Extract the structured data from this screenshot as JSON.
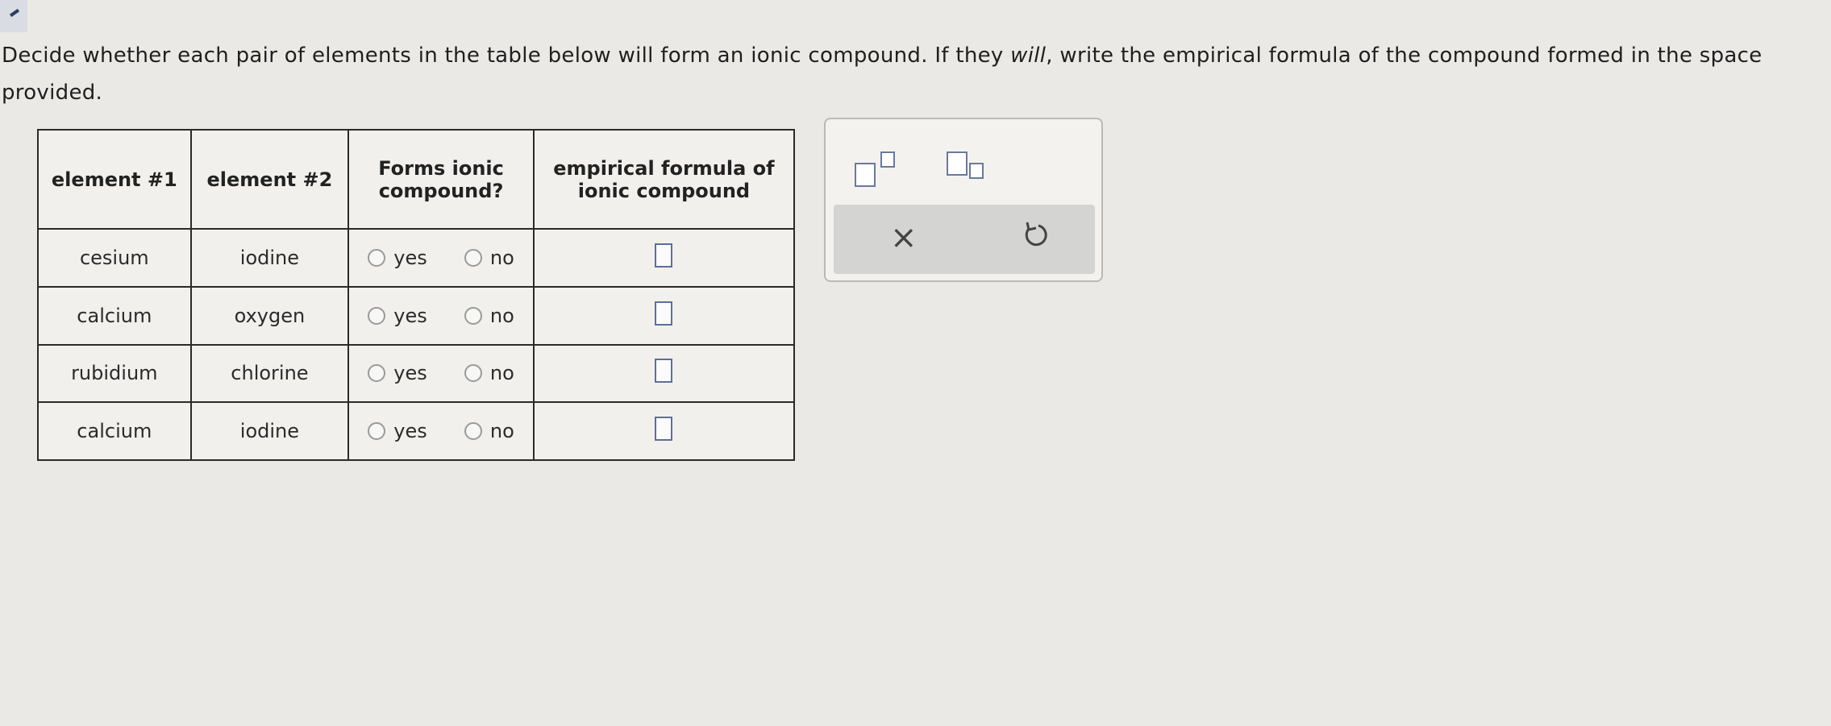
{
  "instruction": {
    "before": "Decide whether each pair of elements in the table below will form an ionic compound. If they ",
    "emphasis": "will",
    "after": ", write the empirical formula of the compound formed in the space provided."
  },
  "table": {
    "headers": {
      "element1": "element #1",
      "element2": "element #2",
      "forms_ionic_line1": "Forms ionic",
      "forms_ionic_line2": "compound?",
      "formula_line1": "empirical formula of",
      "formula_line2": "ionic compound"
    },
    "option_yes": "yes",
    "option_no": "no",
    "rows": [
      {
        "element1": "cesium",
        "element2": "iodine"
      },
      {
        "element1": "calcium",
        "element2": "oxygen"
      },
      {
        "element1": "rubidium",
        "element2": "chlorine"
      },
      {
        "element1": "calcium",
        "element2": "iodine"
      }
    ]
  },
  "tool_panel": {
    "superscript_icon": "superscript-box-icon",
    "subscript_icon": "subscript-box-icon",
    "clear_symbol": "×",
    "undo_icon": "undo-icon"
  },
  "colors": {
    "background": "#ebe9e5",
    "table_border": "#2a2a2a",
    "answer_box_border": "#5d6f99",
    "toolbar_bg": "#d4d4d2"
  }
}
